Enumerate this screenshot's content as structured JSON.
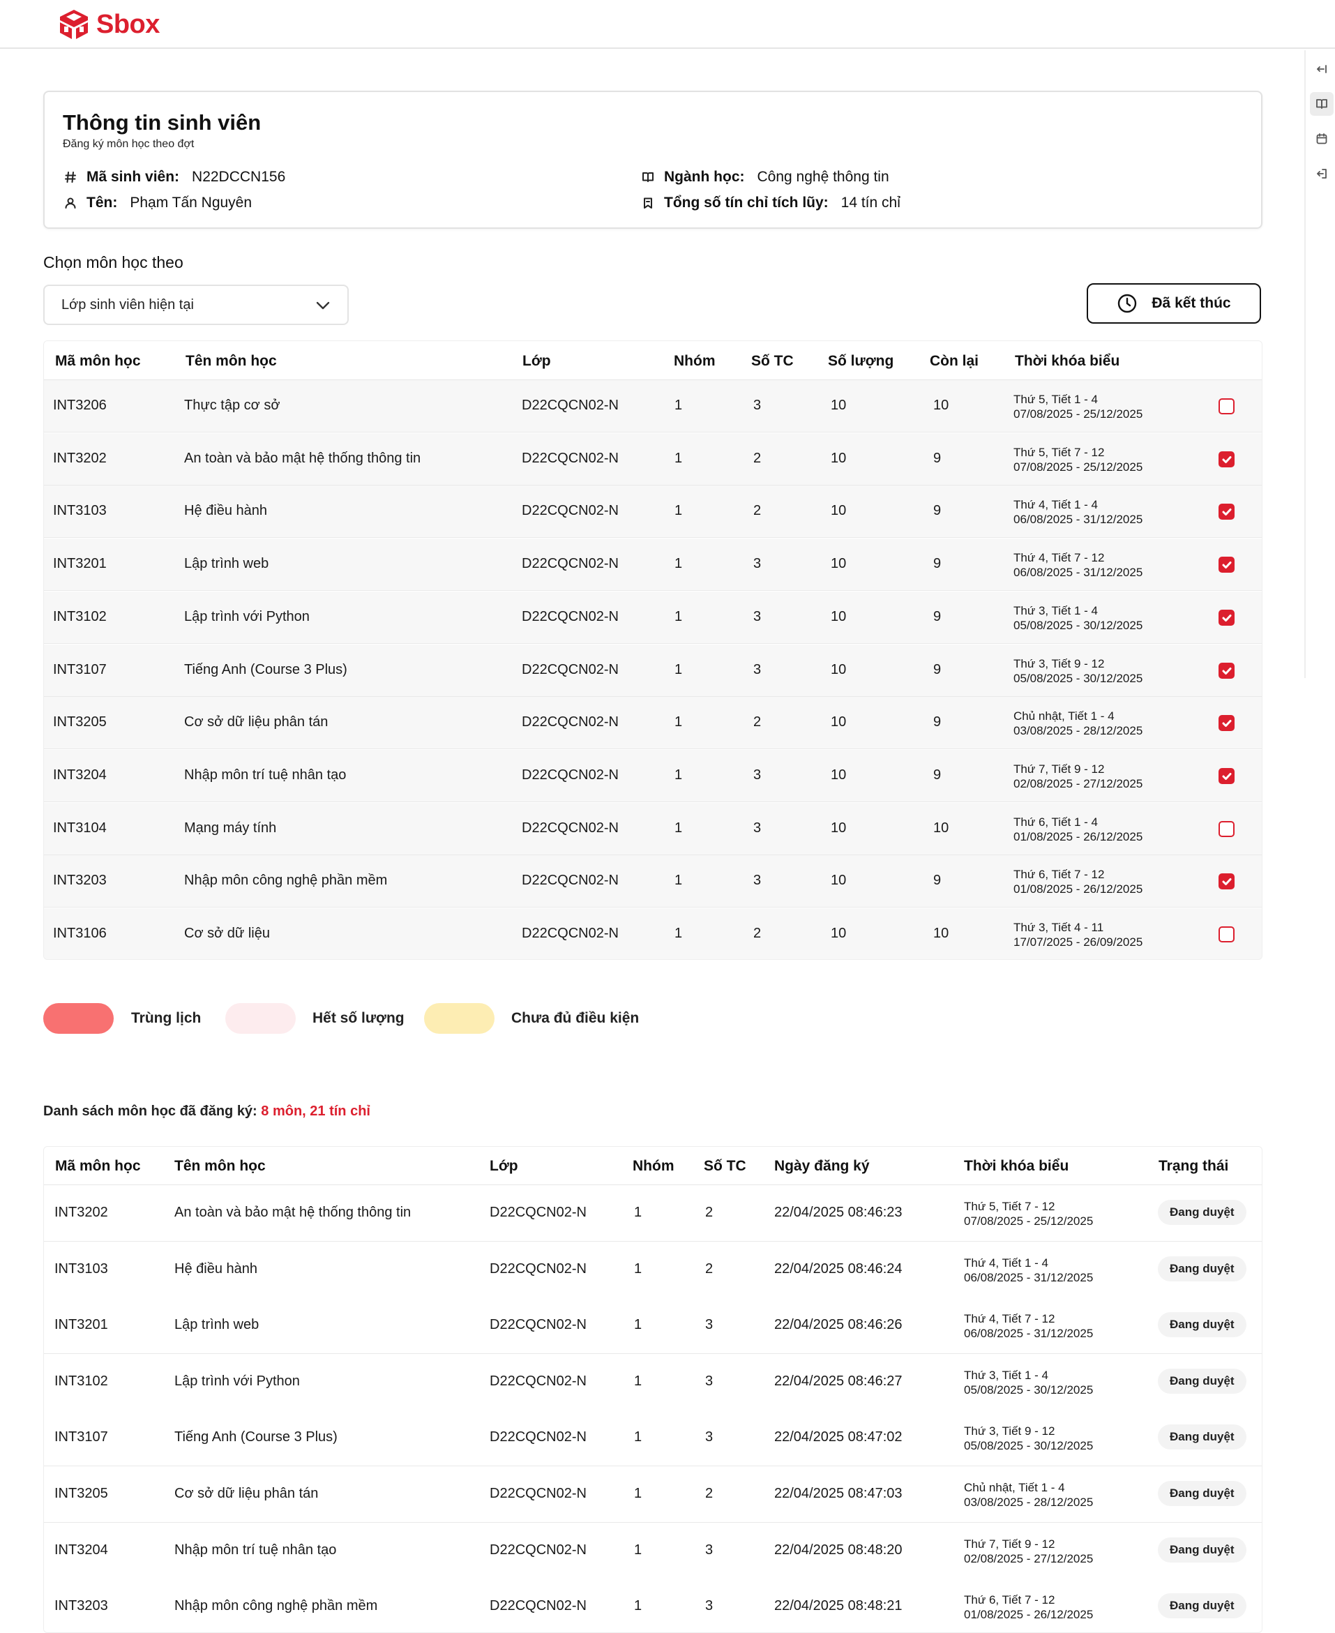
{
  "app": {
    "name": "Sbox",
    "brand_color": "#dc1f2e"
  },
  "rail": {
    "icons": [
      "collapse-icon",
      "book-icon",
      "calendar-icon",
      "logout-icon"
    ]
  },
  "student": {
    "title": "Thông tin sinh viên",
    "subtitle": "Đăng ký môn học theo đợt",
    "id_label": "Mã sinh viên:",
    "id_value": "N22DCCN156",
    "name_label": "Tên:",
    "name_value": "Phạm Tấn Nguyên",
    "major_label": "Ngành học:",
    "major_value": "Công nghệ thông tin",
    "credits_label": "Tổng số tín chỉ tích lũy:",
    "credits_value": "14 tín chỉ"
  },
  "filter": {
    "label": "Chọn môn học theo",
    "selected": "Lớp sinh viên hiện tại",
    "ended_button": "Đã kết thúc"
  },
  "courses": {
    "headers": [
      "Mã môn học",
      "Tên môn học",
      "Lớp",
      "Nhóm",
      "Số TC",
      "Số lượng",
      "Còn lại",
      "Thời khóa biểu"
    ],
    "rows": [
      {
        "code": "INT3206",
        "name": "Thực tập cơ sở",
        "class": "D22CQCN02-N",
        "group": "1",
        "credits": "3",
        "capacity": "10",
        "remaining": "10",
        "schedule": "Thứ 5, Tiết 1 - 4",
        "dates": "07/08/2025 - 25/12/2025",
        "checked": false
      },
      {
        "code": "INT3202",
        "name": "An toàn và bảo mật hệ thống thông tin",
        "class": "D22CQCN02-N",
        "group": "1",
        "credits": "2",
        "capacity": "10",
        "remaining": "9",
        "schedule": "Thứ 5, Tiết 7 - 12",
        "dates": "07/08/2025 - 25/12/2025",
        "checked": true
      },
      {
        "code": "INT3103",
        "name": "Hệ điều hành",
        "class": "D22CQCN02-N",
        "group": "1",
        "credits": "2",
        "capacity": "10",
        "remaining": "9",
        "schedule": "Thứ 4, Tiết 1 - 4",
        "dates": "06/08/2025 - 31/12/2025",
        "checked": true
      },
      {
        "code": "INT3201",
        "name": "Lập trình web",
        "class": "D22CQCN02-N",
        "group": "1",
        "credits": "3",
        "capacity": "10",
        "remaining": "9",
        "schedule": "Thứ 4, Tiết 7 - 12",
        "dates": "06/08/2025 - 31/12/2025",
        "checked": true
      },
      {
        "code": "INT3102",
        "name": "Lập trình với Python",
        "class": "D22CQCN02-N",
        "group": "1",
        "credits": "3",
        "capacity": "10",
        "remaining": "9",
        "schedule": "Thứ 3, Tiết 1 - 4",
        "dates": "05/08/2025 - 30/12/2025",
        "checked": true
      },
      {
        "code": "INT3107",
        "name": "Tiếng Anh (Course 3 Plus)",
        "class": "D22CQCN02-N",
        "group": "1",
        "credits": "3",
        "capacity": "10",
        "remaining": "9",
        "schedule": "Thứ 3, Tiết 9 - 12",
        "dates": "05/08/2025 - 30/12/2025",
        "checked": true
      },
      {
        "code": "INT3205",
        "name": "Cơ sở dữ liệu phân tán",
        "class": "D22CQCN02-N",
        "group": "1",
        "credits": "2",
        "capacity": "10",
        "remaining": "9",
        "schedule": "Chủ nhật, Tiết 1 - 4",
        "dates": "03/08/2025 - 28/12/2025",
        "checked": true
      },
      {
        "code": "INT3204",
        "name": "Nhập môn trí tuệ nhân tạo",
        "class": "D22CQCN02-N",
        "group": "1",
        "credits": "3",
        "capacity": "10",
        "remaining": "9",
        "schedule": "Thứ 7, Tiết 9 - 12",
        "dates": "02/08/2025 - 27/12/2025",
        "checked": true
      },
      {
        "code": "INT3104",
        "name": "Mạng máy tính",
        "class": "D22CQCN02-N",
        "group": "1",
        "credits": "3",
        "capacity": "10",
        "remaining": "10",
        "schedule": "Thứ 6, Tiết 1 - 4",
        "dates": "01/08/2025 - 26/12/2025",
        "checked": false
      },
      {
        "code": "INT3203",
        "name": "Nhập môn công nghệ phần mềm",
        "class": "D22CQCN02-N",
        "group": "1",
        "credits": "3",
        "capacity": "10",
        "remaining": "9",
        "schedule": "Thứ 6, Tiết 7 - 12",
        "dates": "01/08/2025 - 26/12/2025",
        "checked": true
      },
      {
        "code": "INT3106",
        "name": "Cơ sở dữ liệu",
        "class": "D22CQCN02-N",
        "group": "1",
        "credits": "2",
        "capacity": "10",
        "remaining": "10",
        "schedule": "Thứ 3, Tiết 4 - 11",
        "dates": "17/07/2025 - 26/09/2025",
        "checked": false
      }
    ]
  },
  "legend": [
    {
      "label": "Trùng lịch",
      "color": "#f87171"
    },
    {
      "label": "Hết số lượng",
      "color": "#fdecee"
    },
    {
      "label": "Chưa đủ điều kiện",
      "color": "#fdedb3"
    }
  ],
  "summary": {
    "label": "Danh sách môn học đã đăng ký:",
    "value": "8 môn, 21 tín chỉ"
  },
  "registered": {
    "headers": [
      "Mã môn học",
      "Tên môn học",
      "Lớp",
      "Nhóm",
      "Số TC",
      "Ngày đăng ký",
      "Thời khóa biểu",
      "Trạng thái"
    ],
    "rows": [
      {
        "code": "INT3202",
        "name": "An toàn và bảo mật hệ thống thông tin",
        "class": "D22CQCN02-N",
        "group": "1",
        "credits": "2",
        "date": "22/04/2025 08:46:23",
        "schedule": "Thứ 5, Tiết 7 - 12",
        "dates": "07/08/2025 - 25/12/2025",
        "status": "Đang duyệt"
      },
      {
        "code": "INT3103",
        "name": "Hệ điều hành",
        "class": "D22CQCN02-N",
        "group": "1",
        "credits": "2",
        "date": "22/04/2025 08:46:24",
        "schedule": "Thứ 4, Tiết 1 - 4",
        "dates": "06/08/2025 - 31/12/2025",
        "status": "Đang duyệt"
      },
      {
        "code": "INT3201",
        "name": "Lập trình web",
        "class": "D22CQCN02-N",
        "group": "1",
        "credits": "3",
        "date": "22/04/2025 08:46:26",
        "schedule": "Thứ 4, Tiết 7 - 12",
        "dates": "06/08/2025 - 31/12/2025",
        "status": "Đang duyệt"
      },
      {
        "code": "INT3102",
        "name": "Lập trình với Python",
        "class": "D22CQCN02-N",
        "group": "1",
        "credits": "3",
        "date": "22/04/2025 08:46:27",
        "schedule": "Thứ 3, Tiết 1 - 4",
        "dates": "05/08/2025 - 30/12/2025",
        "status": "Đang duyệt"
      },
      {
        "code": "INT3107",
        "name": "Tiếng Anh (Course 3 Plus)",
        "class": "D22CQCN02-N",
        "group": "1",
        "credits": "3",
        "date": "22/04/2025 08:47:02",
        "schedule": "Thứ 3, Tiết 9 - 12",
        "dates": "05/08/2025 - 30/12/2025",
        "status": "Đang duyệt"
      },
      {
        "code": "INT3205",
        "name": "Cơ sở dữ liệu phân tán",
        "class": "D22CQCN02-N",
        "group": "1",
        "credits": "2",
        "date": "22/04/2025 08:47:03",
        "schedule": "Chủ nhật, Tiết 1 - 4",
        "dates": "03/08/2025 - 28/12/2025",
        "status": "Đang duyệt"
      },
      {
        "code": "INT3204",
        "name": "Nhập môn trí tuệ nhân tạo",
        "class": "D22CQCN02-N",
        "group": "1",
        "credits": "3",
        "date": "22/04/2025 08:48:20",
        "schedule": "Thứ 7, Tiết 9 - 12",
        "dates": "02/08/2025 - 27/12/2025",
        "status": "Đang duyệt"
      },
      {
        "code": "INT3203",
        "name": "Nhập môn công nghệ phần mềm",
        "class": "D22CQCN02-N",
        "group": "1",
        "credits": "3",
        "date": "22/04/2025 08:48:21",
        "schedule": "Thứ 6, Tiết 7 - 12",
        "dates": "01/08/2025 - 26/12/2025",
        "status": "Đang duyệt"
      }
    ]
  }
}
